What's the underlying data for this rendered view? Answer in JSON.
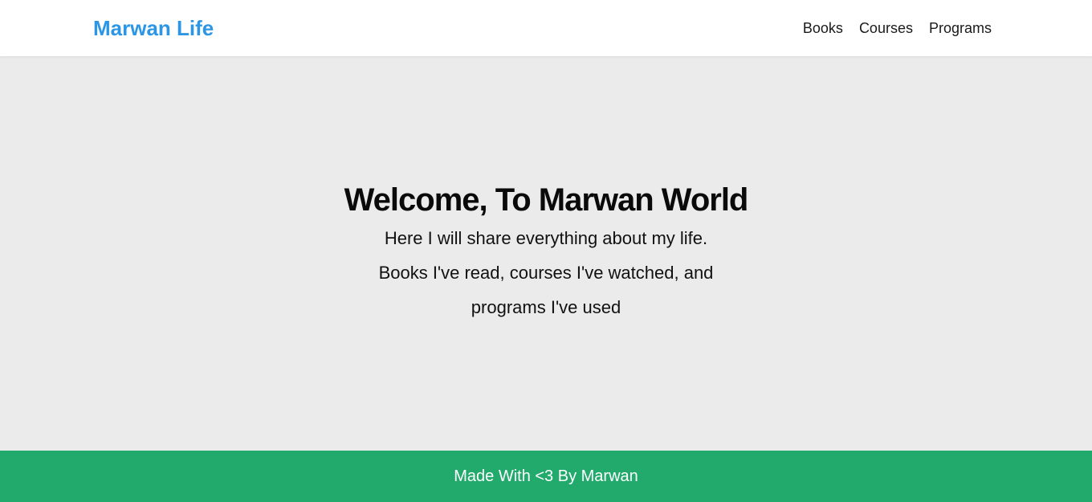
{
  "header": {
    "brand": "Marwan Life",
    "nav": {
      "books": "Books",
      "courses": "Courses",
      "programs": "Programs"
    }
  },
  "hero": {
    "title": "Welcome, To Marwan World",
    "line1": "Here I will share everything about my life.",
    "line2": "Books I've read, courses I've watched, and",
    "line3": "programs I've used"
  },
  "footer": {
    "text": "Made With <3 By Marwan"
  },
  "colors": {
    "brand": "#2b96e6",
    "hero_background": "#ebebeb",
    "footer_background": "#22aa6c"
  }
}
